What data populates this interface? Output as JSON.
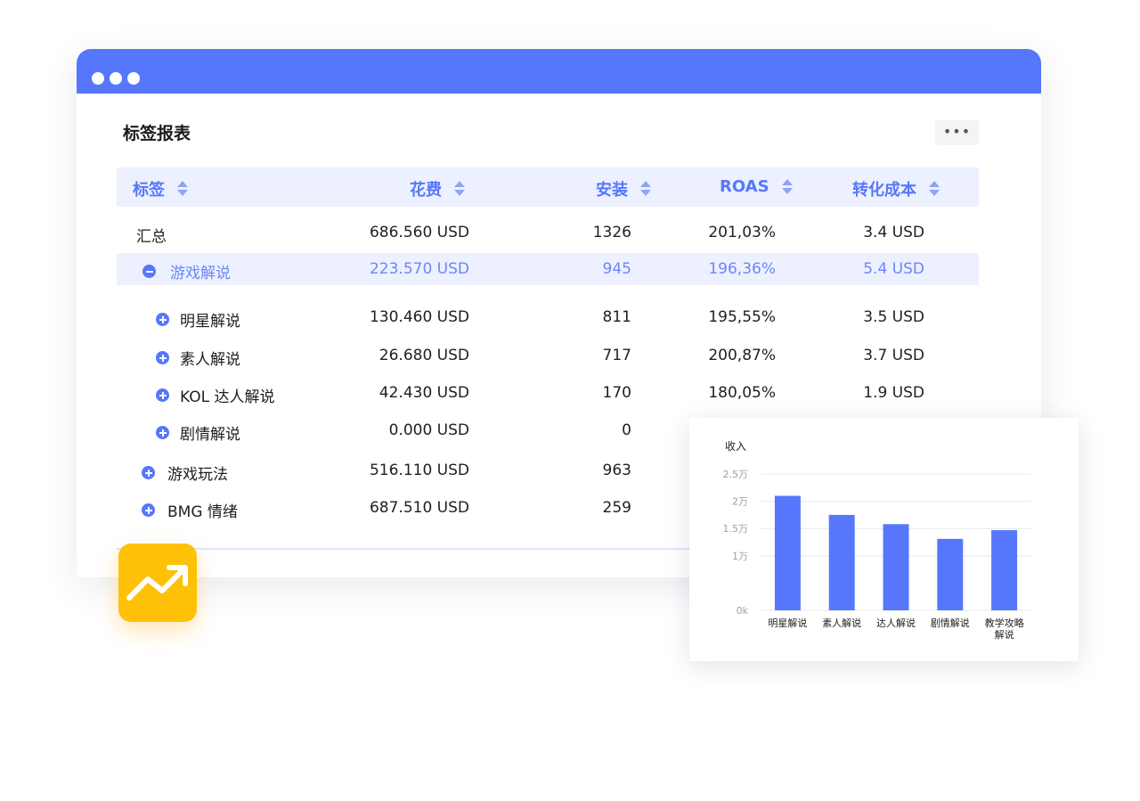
{
  "report": {
    "title": "标签报表",
    "more_label": "•••",
    "columns": {
      "tag": "标签",
      "spend": "花费",
      "installs": "安装",
      "roas": "ROAS",
      "cost": "转化成本"
    },
    "rows": [
      {
        "label": "汇总",
        "spend": "686.560 USD",
        "installs": "1326",
        "roas": "201,03%",
        "cost": "3.4 USD"
      },
      {
        "label": "游戏解说",
        "spend": "223.570 USD",
        "installs": "945",
        "roas": "196,36%",
        "cost": "5.4 USD"
      },
      {
        "label": "明星解说",
        "spend": "130.460 USD",
        "installs": "811",
        "roas": "195,55%",
        "cost": "3.5 USD"
      },
      {
        "label": "素人解说",
        "spend": "26.680 USD",
        "installs": "717",
        "roas": "200,87%",
        "cost": "3.7 USD"
      },
      {
        "label": "KOL 达人解说",
        "spend": "42.430 USD",
        "installs": "170",
        "roas": "180,05%",
        "cost": "1.9 USD"
      },
      {
        "label": "剧情解说",
        "spend": "0.000 USD",
        "installs": "0"
      },
      {
        "label": "游戏玩法",
        "spend": "516.110 USD",
        "installs": "963"
      },
      {
        "label": "BMG 情绪",
        "spend": "687.510 USD",
        "installs": "259"
      }
    ]
  },
  "colors": {
    "accent": "#5677fc",
    "header_bg": "#edf1ff",
    "badge": "#ffc107"
  },
  "badge_icon": "trending-up-icon",
  "chart_data": {
    "type": "bar",
    "ylabel": "收入",
    "categories": [
      "明星解说",
      "素人解说",
      "达人解说",
      "剧情解说",
      "教学攻略解说"
    ],
    "values": [
      21000,
      17500,
      15800,
      13100,
      14700
    ],
    "ylim": [
      0,
      25000
    ],
    "ytick_labels": [
      "0k",
      "1万",
      "1.5万",
      "2万",
      "2.5万"
    ],
    "color": "#5677fc",
    "grid": true
  }
}
